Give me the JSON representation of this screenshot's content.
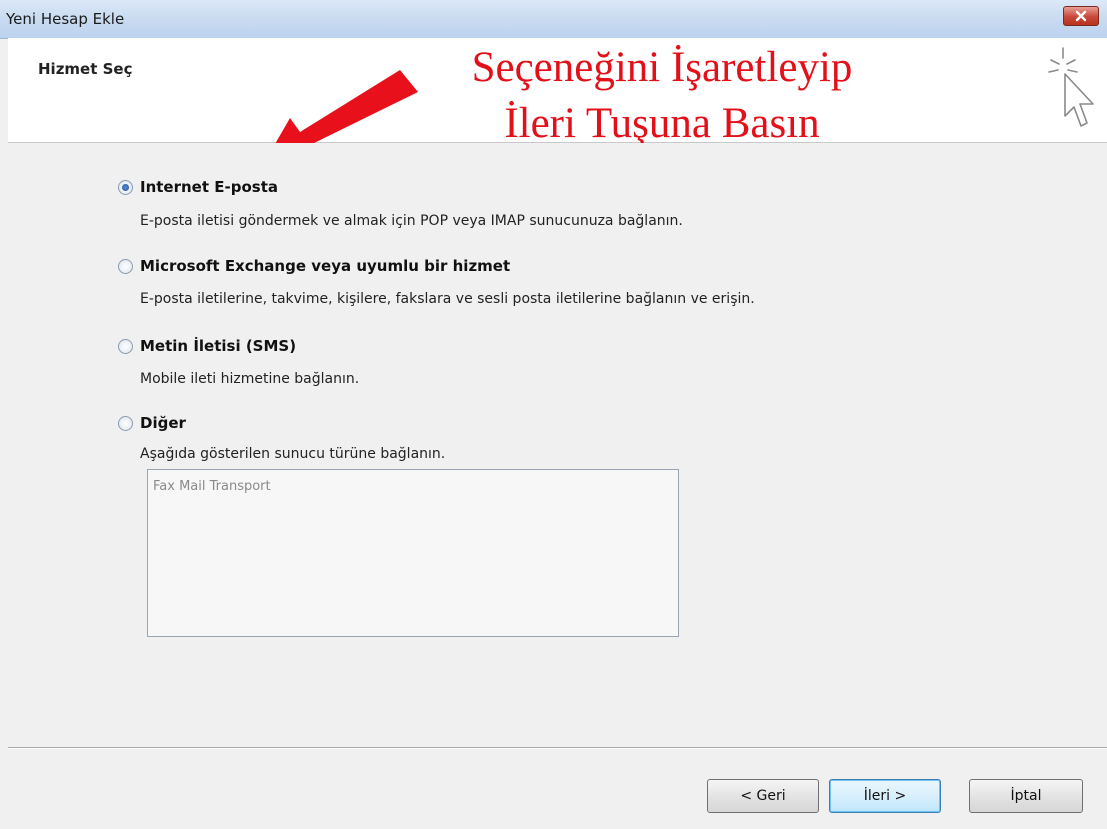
{
  "window": {
    "title": "Yeni Hesap Ekle",
    "close_icon": "close-icon"
  },
  "header": {
    "title": "Hizmet Seç",
    "icon": "cursor-sparkle-icon"
  },
  "annotation": {
    "line1": "Seçeneğini İşaretleyip",
    "line2": "İleri Tuşuna Basın",
    "color": "#e3101a",
    "arrow_icon": "red-arrow-icon"
  },
  "options": [
    {
      "label": "Internet E-posta",
      "description": "E-posta iletisi göndermek ve almak için POP veya IMAP sunucunuza bağlanın.",
      "selected": true
    },
    {
      "label": "Microsoft Exchange veya uyumlu bir hizmet",
      "description": "E-posta iletilerine, takvime, kişilere, fakslara ve sesli posta iletilerine bağlanın ve erişin.",
      "selected": false
    },
    {
      "label": "Metin İletisi (SMS)",
      "description": "Mobile ileti hizmetine bağlanın.",
      "selected": false
    },
    {
      "label": "Diğer",
      "description": "Aşağıda gösterilen sunucu türüne bağlanın.",
      "selected": false
    }
  ],
  "server_list": {
    "items": [
      "Fax Mail Transport"
    ]
  },
  "buttons": {
    "back": "< Geri",
    "next": "İleri >",
    "cancel": "İptal"
  }
}
